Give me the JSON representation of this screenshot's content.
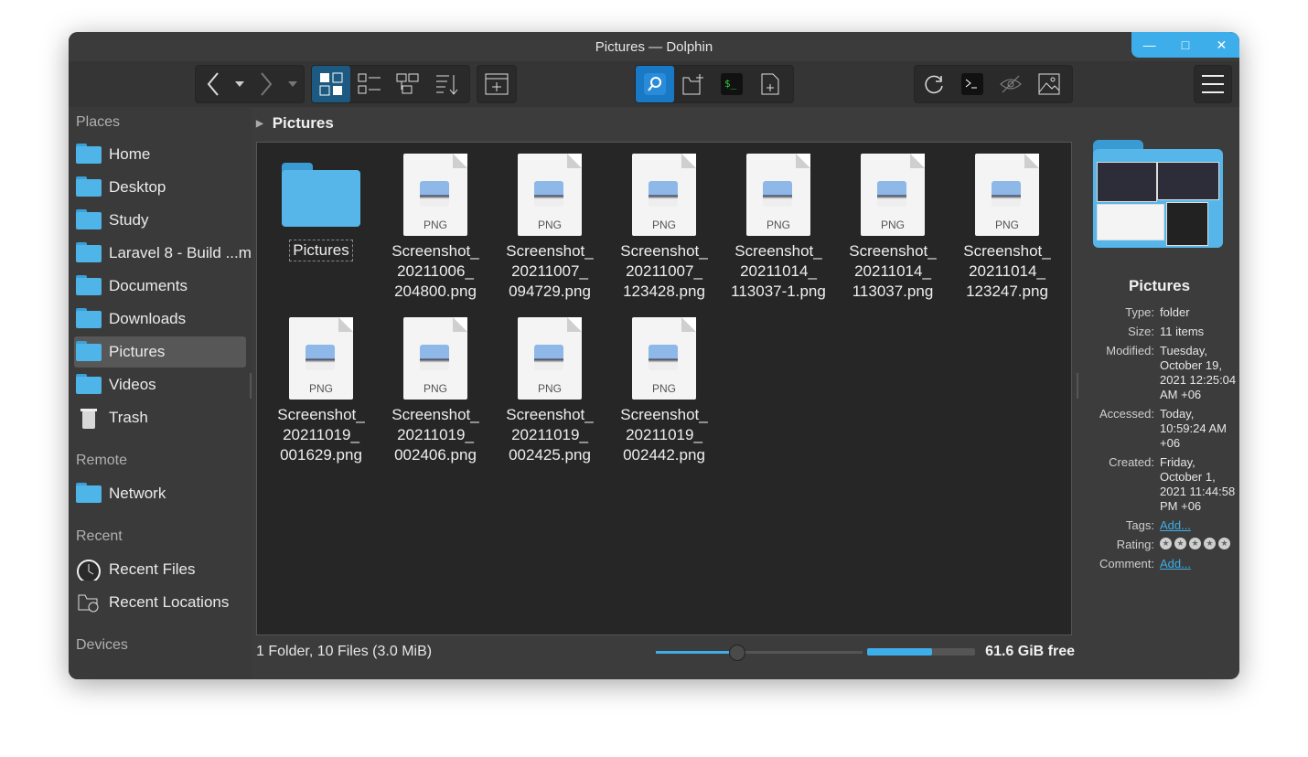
{
  "window": {
    "title": "Pictures — Dolphin",
    "controls": {
      "minimize": "—",
      "maximize": "□",
      "close": "✕"
    }
  },
  "places": {
    "header_places": "Places",
    "items": [
      {
        "label": "Home",
        "icon": "home-folder-icon"
      },
      {
        "label": "Desktop",
        "icon": "desktop-folder-icon"
      },
      {
        "label": "Study",
        "icon": "folder-icon"
      },
      {
        "label": "Laravel 8 - Build ...m",
        "icon": "folder-icon"
      },
      {
        "label": "Documents",
        "icon": "documents-folder-icon"
      },
      {
        "label": "Downloads",
        "icon": "downloads-folder-icon"
      },
      {
        "label": "Pictures",
        "icon": "pictures-folder-icon",
        "selected": true
      },
      {
        "label": "Videos",
        "icon": "videos-folder-icon"
      },
      {
        "label": "Trash",
        "icon": "trash-icon"
      }
    ],
    "header_remote": "Remote",
    "remote_items": [
      {
        "label": "Network",
        "icon": "network-folder-icon"
      }
    ],
    "header_recent": "Recent",
    "recent_items": [
      {
        "label": "Recent Files",
        "icon": "clock-icon"
      },
      {
        "label": "Recent Locations",
        "icon": "recent-locations-icon"
      }
    ],
    "header_devices": "Devices"
  },
  "breadcrumb": {
    "current": "Pictures"
  },
  "files": {
    "items": [
      {
        "name": "Pictures",
        "type": "folder"
      },
      {
        "name": "Screenshot_20211006_204800.png",
        "line1": "Screenshot_",
        "line2": "20211006_",
        "line3": "204800.png",
        "type": "png"
      },
      {
        "name": "Screenshot_20211007_094729.png",
        "line1": "Screenshot_",
        "line2": "20211007_",
        "line3": "094729.png",
        "type": "png"
      },
      {
        "name": "Screenshot_20211007_123428.png",
        "line1": "Screenshot_",
        "line2": "20211007_",
        "line3": "123428.png",
        "type": "png"
      },
      {
        "name": "Screenshot_20211014_113037-1.png",
        "line1": "Screenshot_",
        "line2": "20211014_",
        "line3": "113037-1.png",
        "type": "png"
      },
      {
        "name": "Screenshot_20211014_113037.png",
        "line1": "Screenshot_",
        "line2": "20211014_",
        "line3": "113037.png",
        "type": "png"
      },
      {
        "name": "Screenshot_20211014_123247.png",
        "line1": "Screenshot_",
        "line2": "20211014_",
        "line3": "123247.png",
        "type": "png"
      },
      {
        "name": "Screenshot_20211019_001629.png",
        "line1": "Screenshot_",
        "line2": "20211019_",
        "line3": "001629.png",
        "type": "png"
      },
      {
        "name": "Screenshot_20211019_002406.png",
        "line1": "Screenshot_",
        "line2": "20211019_",
        "line3": "002406.png",
        "type": "png"
      },
      {
        "name": "Screenshot_20211019_002425.png",
        "line1": "Screenshot_",
        "line2": "20211019_",
        "line3": "002425.png",
        "type": "png"
      },
      {
        "name": "Screenshot_20211019_002442.png",
        "line1": "Screenshot_",
        "line2": "20211019_",
        "line3": "002442.png",
        "type": "png"
      }
    ],
    "png_label": "PNG"
  },
  "status": {
    "summary": "1 Folder, 10 Files (3.0 MiB)",
    "zoom_fraction": 0.39,
    "disk_used_fraction": 0.6,
    "free_space": "61.6 GiB free"
  },
  "info_panel": {
    "name": "Pictures",
    "fields": [
      {
        "key": "Type:",
        "value": "folder"
      },
      {
        "key": "Size:",
        "value": "11 items"
      },
      {
        "key": "Modified:",
        "value": "Tuesday, October 19, 2021 12:25:04 AM +06"
      },
      {
        "key": "Accessed:",
        "value": "Today, 10:59:24 AM +06"
      },
      {
        "key": "Created:",
        "value": "Friday, October 1, 2021 11:44:58 PM +06"
      },
      {
        "key": "Tags:",
        "value": "Add..."
      },
      {
        "key": "Rating:",
        "value": ""
      },
      {
        "key": "Comment:",
        "value": "Add..."
      }
    ],
    "rating_stars": 5
  },
  "colors": {
    "accent": "#3daee9",
    "window_bg": "#3c3c3c",
    "view_bg": "#262626"
  }
}
